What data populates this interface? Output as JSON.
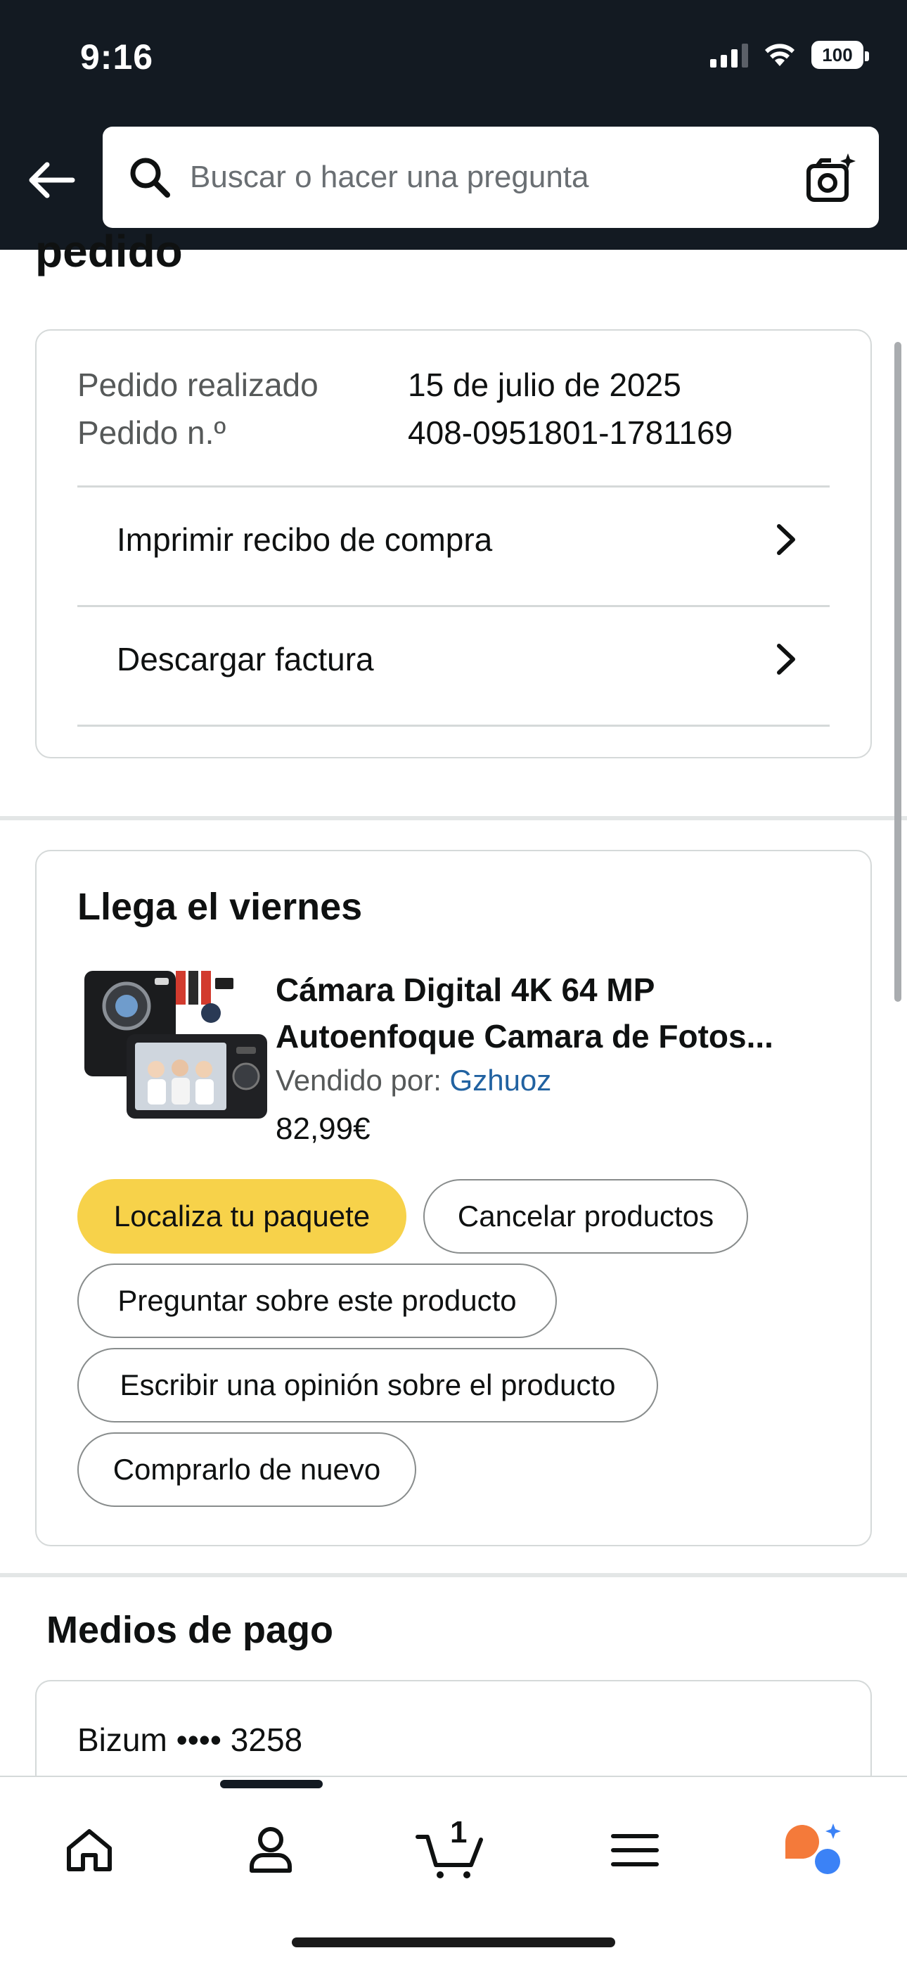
{
  "status_bar": {
    "time": "9:16",
    "battery": "100"
  },
  "header": {
    "search_placeholder": "Buscar o hacer una pregunta"
  },
  "section_title_partial": "pedido",
  "order": {
    "placed_label": "Pedido realizado",
    "placed_value": "15 de julio de 2025",
    "number_label": "Pedido n.º",
    "number_value": "408-0951801-1781169",
    "links": [
      {
        "label": "Imprimir recibo de compra"
      },
      {
        "label": "Descargar factura"
      }
    ]
  },
  "item": {
    "arrival": "Llega el viernes",
    "title_line1": "Cámara Digital 4K 64 MP",
    "title_line2": "Autoenfoque Camara de Fotos...",
    "seller_label": "Vendido por:",
    "seller_name": "Gzhuoz",
    "price": "82,99€",
    "buttons": {
      "track": "Localiza tu paquete",
      "cancel": "Cancelar productos",
      "ask": "Preguntar sobre este producto",
      "review": "Escribir una opinión sobre el producto",
      "buy_again": "Comprarlo de nuevo"
    }
  },
  "payment": {
    "title": "Medios de pago",
    "method": "Bizum •••• 3258"
  },
  "bottom_nav": {
    "cart_count": "1",
    "items": [
      "home-icon",
      "account-icon",
      "cart-icon",
      "menu-icon",
      "rufus-icon"
    ]
  },
  "colors": {
    "header_bg": "#131a22",
    "primary_button": "#f7d24a",
    "link": "#2162a1"
  }
}
